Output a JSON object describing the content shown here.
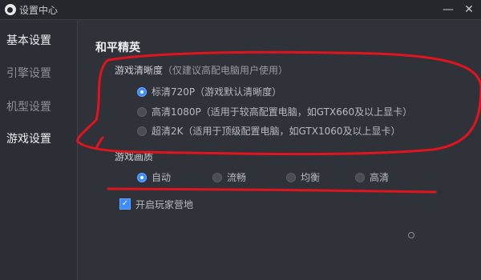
{
  "window": {
    "title": "设置中心",
    "minimize_icon": "minimize-icon",
    "close_icon": "close-icon"
  },
  "sidebar": {
    "items": [
      {
        "label": "基本设置"
      },
      {
        "label": "引擎设置"
      },
      {
        "label": "机型设置"
      },
      {
        "label": "游戏设置"
      }
    ]
  },
  "main": {
    "game_title": "和平精英",
    "resolution": {
      "label": "游戏清晰度",
      "note": "（仅建议高配电脑用户使用）",
      "options": [
        {
          "label": "标清720P",
          "note": "（游戏默认清晰度）",
          "selected": true
        },
        {
          "label": "高清1080P",
          "note": "（适用于较高配置电脑，如GTX660及以上显卡）",
          "selected": false
        },
        {
          "label": "超清2K",
          "note": "（适用于顶级配置电脑，如GTX1060及以上显卡）",
          "selected": false
        }
      ]
    },
    "quality": {
      "label": "游戏画质",
      "options": [
        {
          "label": "自动",
          "selected": true
        },
        {
          "label": "流畅",
          "selected": false
        },
        {
          "label": "均衡",
          "selected": false
        },
        {
          "label": "高清",
          "selected": false
        }
      ]
    },
    "checkbox": {
      "label": "开启玩家营地",
      "checked": true
    }
  },
  "colors": {
    "accent": "#3b8cff",
    "annotation": "#e0141e"
  }
}
